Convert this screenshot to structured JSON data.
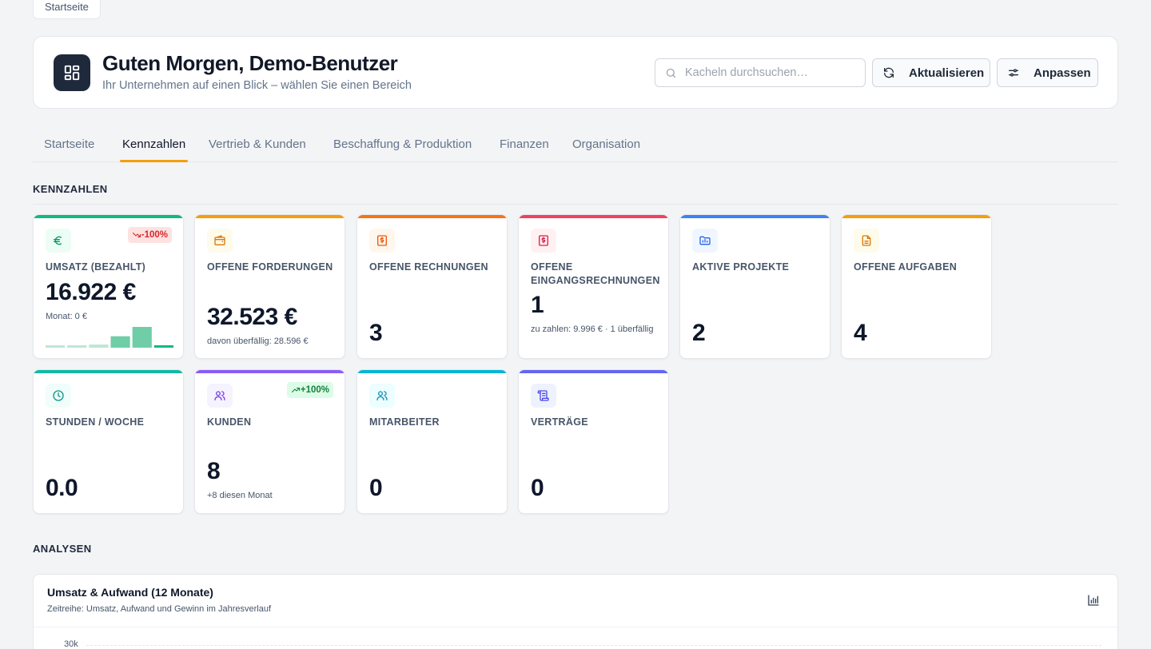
{
  "breadcrumb": "Startseite",
  "header": {
    "title": "Guten Morgen, Demo-Benutzer",
    "subtitle": "Ihr Unternehmen auf einen Blick – wählen Sie einen Bereich",
    "search_placeholder": "Kacheln durchsuchen…",
    "refresh_label": "Aktualisieren",
    "customize_label": "Anpassen"
  },
  "tabs": [
    {
      "label": "Startseite",
      "active": false
    },
    {
      "label": "Kennzahlen",
      "active": true
    },
    {
      "label": "Vertrieb & Kunden",
      "active": false
    },
    {
      "label": "Beschaffung & Produktion",
      "active": false
    },
    {
      "label": "Finanzen",
      "active": false
    },
    {
      "label": "Organisation",
      "active": false
    }
  ],
  "sections": {
    "kennzahlen": "KENNZAHLEN",
    "analysen": "ANALYSEN"
  },
  "cards": [
    {
      "label": "UMSATZ (BEZAHLT)",
      "value": "16.922 €",
      "sub": "Monat: 0 €",
      "badge": "-100%",
      "trend": "down",
      "color": "#10b981",
      "icon": "euro-icon"
    },
    {
      "label": "OFFENE FORDERUNGEN",
      "value": "32.523 €",
      "sub": "davon überfällig: 28.596 €",
      "color": "#f59e0b",
      "icon": "wallet-icon"
    },
    {
      "label": "OFFENE RECHNUNGEN",
      "value": "3",
      "color": "#f97316",
      "icon": "invoice-icon"
    },
    {
      "label": "OFFENE EINGANGSRECHNUNGEN",
      "value": "1",
      "sub": "zu zahlen: 9.996 € · 1 überfällig",
      "color": "#f43f5e",
      "icon": "receipt-icon"
    },
    {
      "label": "AKTIVE PROJEKTE",
      "value": "2",
      "color": "#3b82f6",
      "icon": "folder-chart-icon"
    },
    {
      "label": "OFFENE AUFGABEN",
      "value": "4",
      "color": "#f59e0b",
      "icon": "document-icon"
    },
    {
      "label": "STUNDEN / WOCHE",
      "value": "0.0",
      "color": "#14b8a6",
      "icon": "clock-icon"
    },
    {
      "label": "KUNDEN",
      "value": "8",
      "sub": "+8 diesen Monat",
      "badge": "+100%",
      "trend": "up",
      "color": "#8b5cf6",
      "icon": "users-icon"
    },
    {
      "label": "MITARBEITER",
      "value": "0",
      "color": "#06b6d4",
      "icon": "team-icon"
    },
    {
      "label": "VERTRÄGE",
      "value": "0",
      "color": "#6366f1",
      "icon": "scroll-icon"
    }
  ],
  "umsatz_sparkline": [
    0.1,
    0.1,
    0.15,
    0.55,
    1.0,
    0.1
  ],
  "panel": {
    "title": "Umsatz & Aufwand (12 Monate)",
    "subtitle": "Zeitreihe: Umsatz, Aufwand und Gewinn im Jahresverlauf",
    "first_tick": "30k"
  }
}
